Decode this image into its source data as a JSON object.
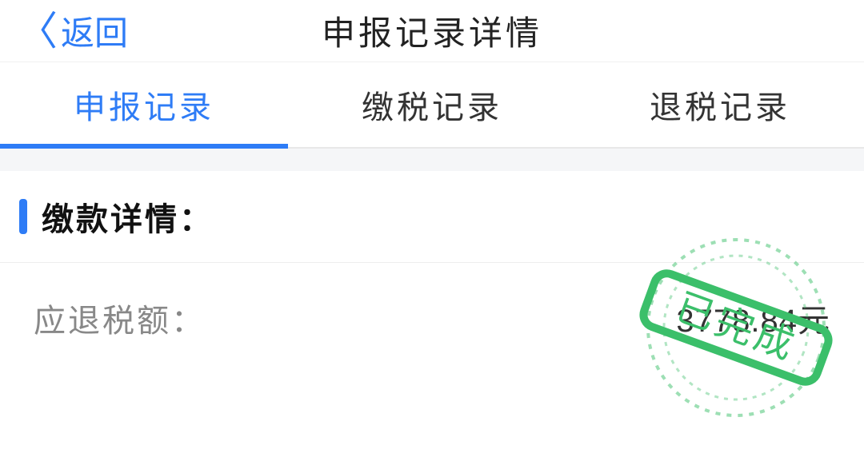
{
  "navbar": {
    "back_label": "返回",
    "title": "申报记录详情"
  },
  "tabs": [
    {
      "label": "申报记录",
      "active": true
    },
    {
      "label": "缴税记录",
      "active": false
    },
    {
      "label": "退税记录",
      "active": false
    }
  ],
  "section": {
    "title": "缴款详情："
  },
  "rows": [
    {
      "label": "应退税额：",
      "value": "3778.84元"
    }
  ],
  "stamp": {
    "text": "已完成",
    "color": "#3bbf6a"
  }
}
